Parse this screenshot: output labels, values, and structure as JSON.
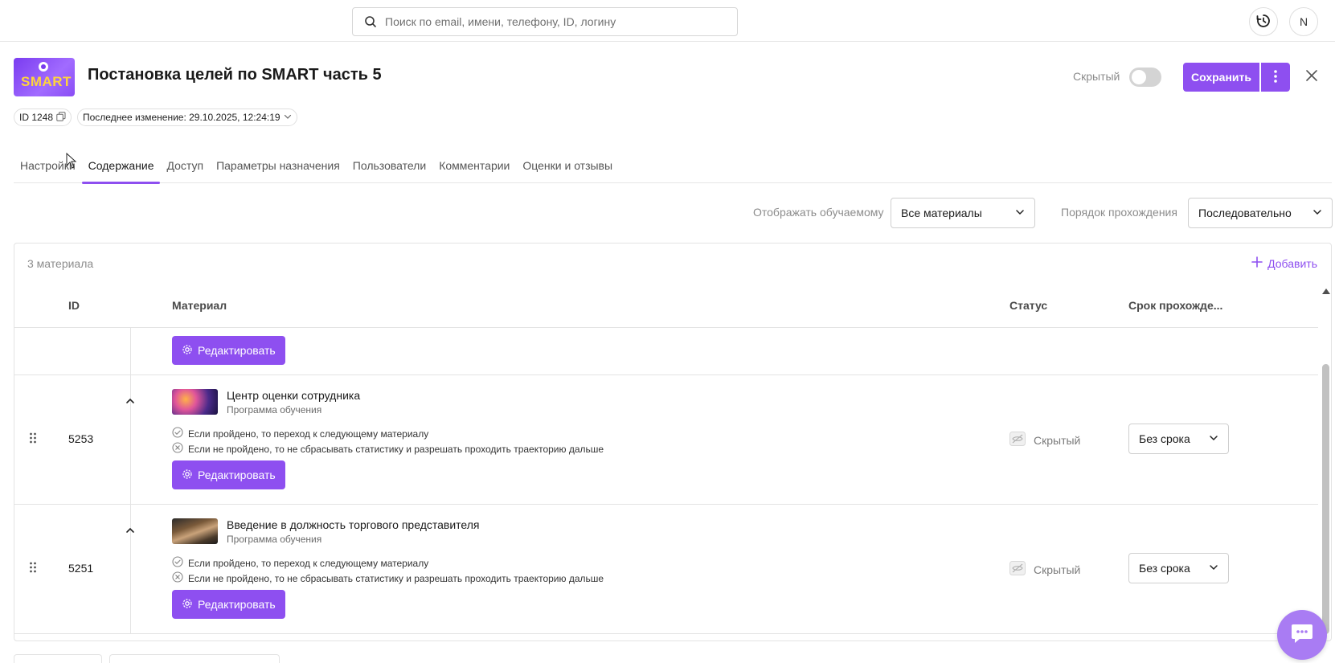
{
  "search": {
    "placeholder": "Поиск по email, имени, телефону, ID, логину",
    "value": ""
  },
  "user": {
    "initial": "N"
  },
  "course": {
    "logo_text": "SMART",
    "title": "Постановка целей по SMART часть 5",
    "hidden_label": "Скрытый",
    "save_label": "Сохранить",
    "id_chip": "ID 1248",
    "last_change": "Последнее изменение: 29.10.2025, 12:24:19"
  },
  "tabs": [
    {
      "label": "Настройки",
      "active": false
    },
    {
      "label": "Содержание",
      "active": true
    },
    {
      "label": "Доступ",
      "active": false
    },
    {
      "label": "Параметры назначения",
      "active": false
    },
    {
      "label": "Пользователи",
      "active": false
    },
    {
      "label": "Комментарии",
      "active": false
    },
    {
      "label": "Оценки и отзывы",
      "active": false
    }
  ],
  "filters": {
    "display_label": "Отображать обучаемому",
    "display_value": "Все материалы",
    "order_label": "Порядок прохождения",
    "order_value": "Последовательно"
  },
  "materials": {
    "count": "3 материала",
    "add_label": "Добавить",
    "columns": {
      "id": "ID",
      "material": "Материал",
      "status": "Статус",
      "due": "Срок прохожде..."
    },
    "edit_label": "Редактировать",
    "rows": [
      {
        "id": "5253",
        "title": "Центр оценки сотрудника",
        "subtitle": "Программа обучения",
        "cond_passed": "Если пройдено, то переход к следующему материалу",
        "cond_failed": "Если не пройдено, то не сбрасывать статистику и разрешать проходить траекторию дальше",
        "status": "Скрытый",
        "due": "Без срока"
      },
      {
        "id": "5251",
        "title": "Введение в должность торгового представителя",
        "subtitle": "Программа обучения",
        "cond_passed": "Если пройдено, то переход к следующему материалу",
        "cond_failed": "Если не пройдено, то не сбрасывать статистику и разрешать проходить траекторию дальше",
        "status": "Скрытый",
        "due": "Без срока"
      }
    ]
  },
  "colors": {
    "accent": "#8e4ff0",
    "border": "#e3e3e3",
    "muted": "#8c8c8c"
  }
}
